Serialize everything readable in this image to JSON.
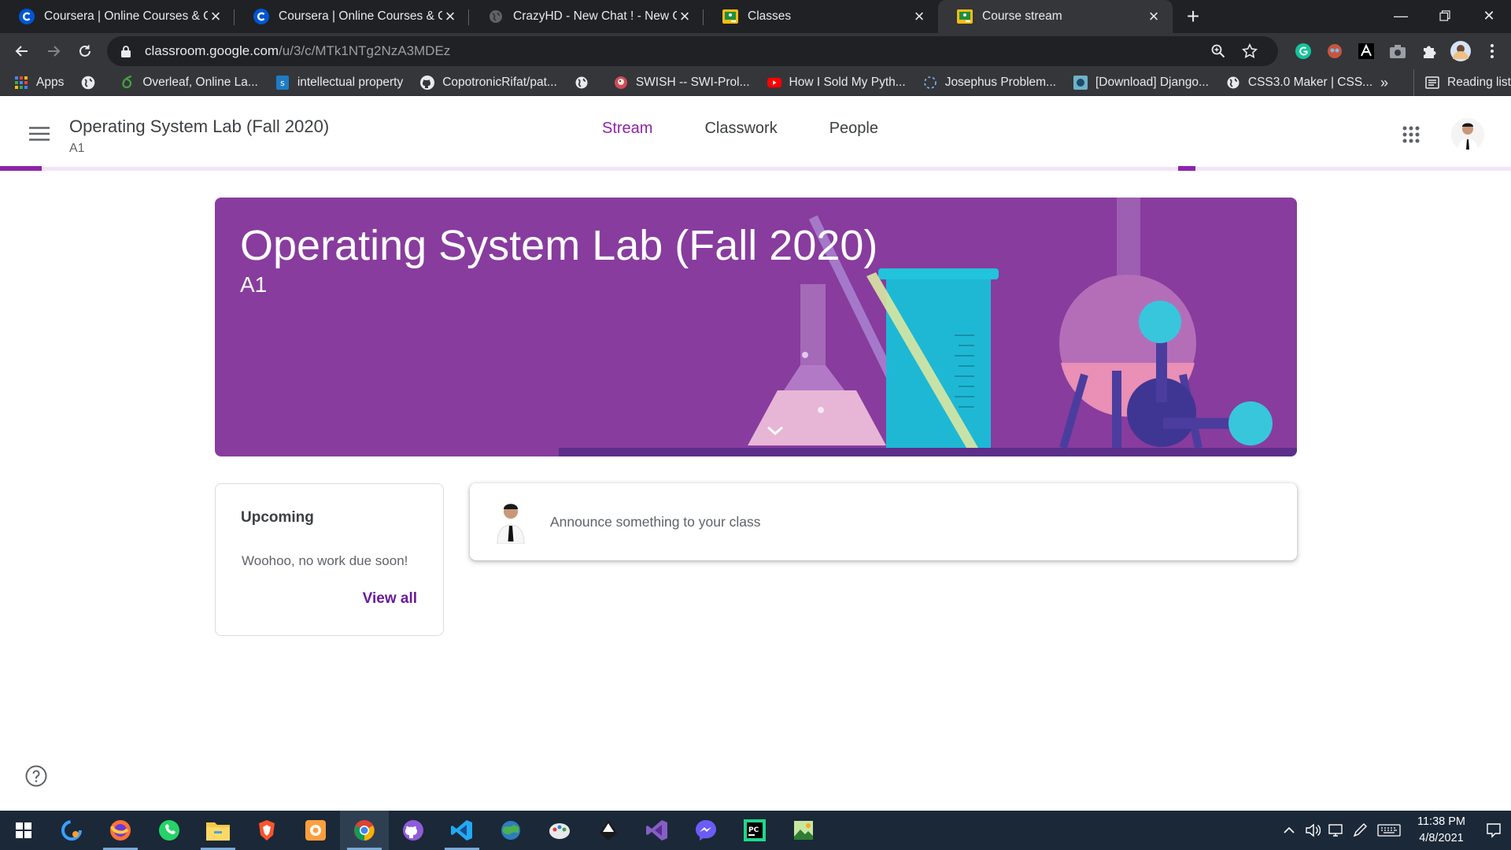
{
  "browser": {
    "tabs": [
      {
        "title": "Coursera | Online Courses & Credentials",
        "icon": "coursera-icon"
      },
      {
        "title": "Coursera | Online Courses & Credentials",
        "icon": "coursera-icon"
      },
      {
        "title": "CrazyHD - New Chat ! - New Chat",
        "icon": "globe-icon"
      },
      {
        "title": "Classes",
        "icon": "google-classroom-icon"
      },
      {
        "title": "Course stream",
        "icon": "google-classroom-icon"
      }
    ],
    "active_tab_index": 4,
    "url_host": "classroom.google.com",
    "url_path": "/u/3/c/MTk1NTg2NzA3MDEz",
    "bookmarks": [
      {
        "label": "Apps",
        "icon": "apps-grid-icon"
      },
      {
        "label": "",
        "icon": "globe-icon"
      },
      {
        "label": "Overleaf, Online La...",
        "icon": "overleaf-icon"
      },
      {
        "label": "intellectual property",
        "icon": "scribd-icon"
      },
      {
        "label": "CopotronicRifat/pat...",
        "icon": "github-icon"
      },
      {
        "label": "",
        "icon": "globe-icon"
      },
      {
        "label": "SWISH -- SWI-Prol...",
        "icon": "swish-icon"
      },
      {
        "label": "How I Sold My Pyth...",
        "icon": "youtube-icon"
      },
      {
        "label": "Josephus Problem...",
        "icon": "loading-icon"
      },
      {
        "label": "[Download] Django...",
        "icon": "site-icon"
      },
      {
        "label": "CSS3.0 Maker | CSS...",
        "icon": "globe-icon"
      }
    ],
    "more_bookmarks": "»",
    "reading_list": "Reading list"
  },
  "classroom": {
    "header_title": "Operating System Lab (Fall 2020)",
    "header_section": "A1",
    "nav_tabs": [
      "Stream",
      "Classwork",
      "People"
    ],
    "active_nav": "Stream",
    "banner_title": "Operating System Lab (Fall 2020)",
    "banner_section": "A1",
    "upcoming": {
      "title": "Upcoming",
      "empty_text": "Woohoo, no work due soon!",
      "view_all": "View all"
    },
    "announce_placeholder": "Announce something to your class",
    "theme_color": "#8e24aa"
  },
  "taskbar": {
    "time": "11:38 PM",
    "date": "4/8/2021"
  }
}
